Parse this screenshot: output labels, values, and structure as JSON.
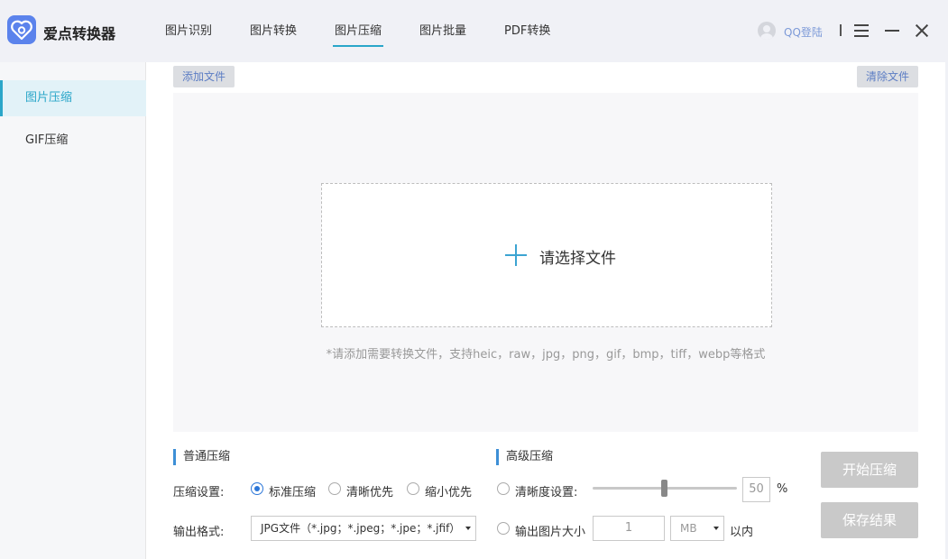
{
  "app": {
    "title": "爱点转换器"
  },
  "nav": {
    "tabs": [
      {
        "label": "图片识别"
      },
      {
        "label": "图片转换"
      },
      {
        "label": "图片压缩"
      },
      {
        "label": "图片批量"
      },
      {
        "label": "PDF转换"
      }
    ],
    "active_tab": "图片压缩",
    "login_label": "QQ登陆",
    "sep_label": "|"
  },
  "sidebar": {
    "items": [
      {
        "label": "图片压缩"
      },
      {
        "label": "GIF压缩"
      }
    ],
    "active_item": "图片压缩"
  },
  "toolbar": {
    "add_file": "添加文件",
    "clear_file": "清除文件"
  },
  "dropzone": {
    "prompt": "请选择文件",
    "hint": "*请添加需要转换文件，支持heic，raw，jpg，png，gif，bmp，tiff，webp等格式"
  },
  "normal": {
    "title": "普通压缩",
    "setting_label": "压缩设置:",
    "options": [
      {
        "label": "标准压缩",
        "checked": true
      },
      {
        "label": "清晰优先",
        "checked": false
      },
      {
        "label": "缩小优先",
        "checked": false
      }
    ],
    "format_label": "输出格式:",
    "format_value": "JPG文件（*.jpg；*.jpeg；*.jpe；*.jfif）"
  },
  "advanced": {
    "title": "高级压缩",
    "clarity_label": "清晰度设置:",
    "clarity_value": "50",
    "clarity_unit": "%",
    "clarity_level": 0.5,
    "size_label": "输出图片大小",
    "size_value": "1",
    "size_unit": "MB",
    "size_suffix": "以内"
  },
  "actions": {
    "start": "开始压缩",
    "save": "保存结果"
  },
  "colors": {
    "accent": "#2aa6c9",
    "brand": "#5b83ec",
    "radio": "#2b76d8",
    "disabled_button": "#c9c9c9"
  }
}
